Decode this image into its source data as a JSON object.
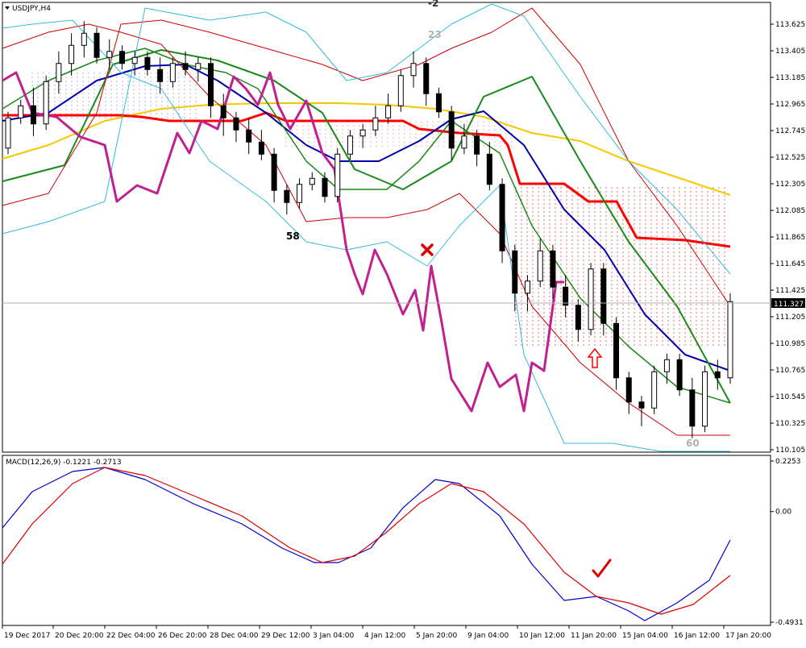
{
  "main_chart": {
    "title": "USDJPY,H4",
    "current_price": "111.327",
    "y_ticks": [
      "113.625",
      "113.405",
      "113.185",
      "112.965",
      "112.745",
      "112.525",
      "112.305",
      "112.085",
      "111.865",
      "111.645",
      "111.425",
      "111.205",
      "110.985",
      "110.765",
      "110.545",
      "110.325",
      "110.105"
    ],
    "annotations": {
      "top_number": "-2",
      "gray_number": "23",
      "low_number": "58",
      "bottom_number": "60"
    }
  },
  "macd_panel": {
    "title": "MACD(12,26,9) -0.1221 -0.2713",
    "y_ticks": [
      "0.2253",
      "0.00",
      "-0.4931"
    ]
  },
  "x_ticks": [
    "19 Dec 2017",
    "20 Dec 20:00",
    "22 Dec 04:00",
    "26 Dec 20:00",
    "28 Dec 04:00",
    "29 Dec 12:00",
    "3 Jan 04:00",
    "4 Jan 12:00",
    "5 Jan 20:00",
    "9 Jan 04:00",
    "10 Jan 12:00",
    "11 Jan 20:00",
    "15 Jan 04:00",
    "16 Jan 12:00",
    "17 Jan 20:00"
  ],
  "colors": {
    "bull_candle": "#ffffff",
    "bear_candle": "#000000",
    "ma_fast": "#0000aa",
    "ma_slow": "#f5c800",
    "stop_line": "#ff0000",
    "bollinger_inner": "#1a8a1a",
    "bollinger_outer": "#cc0000",
    "envelope": "#33bbdd",
    "oscillator": "#c02090",
    "macd_line": "#0000cc",
    "signal_line": "#dd0000",
    "cross_mark": "#dd0000",
    "check_mark": "#dd0000",
    "arrow": "#ff0000"
  },
  "chart_data": {
    "type": "candlestick",
    "symbol": "USDJPY",
    "timeframe": "H4",
    "y_range": [
      110.105,
      113.625
    ],
    "ohlc": [
      {
        "o": 112.6,
        "h": 112.9,
        "l": 112.55,
        "c": 112.85
      },
      {
        "o": 112.85,
        "h": 113.0,
        "l": 112.8,
        "c": 112.95
      },
      {
        "o": 112.95,
        "h": 113.1,
        "l": 112.7,
        "c": 112.8
      },
      {
        "o": 112.8,
        "h": 113.2,
        "l": 112.75,
        "c": 113.15
      },
      {
        "o": 113.15,
        "h": 113.4,
        "l": 113.05,
        "c": 113.3
      },
      {
        "o": 113.3,
        "h": 113.55,
        "l": 113.2,
        "c": 113.45
      },
      {
        "o": 113.45,
        "h": 113.65,
        "l": 113.35,
        "c": 113.55
      },
      {
        "o": 113.55,
        "h": 113.6,
        "l": 113.3,
        "c": 113.35
      },
      {
        "o": 113.35,
        "h": 113.5,
        "l": 113.25,
        "c": 113.4
      },
      {
        "o": 113.4,
        "h": 113.45,
        "l": 113.25,
        "c": 113.3
      },
      {
        "o": 113.3,
        "h": 113.4,
        "l": 113.2,
        "c": 113.35
      },
      {
        "o": 113.35,
        "h": 113.4,
        "l": 113.2,
        "c": 113.25
      },
      {
        "o": 113.25,
        "h": 113.35,
        "l": 113.05,
        "c": 113.15
      },
      {
        "o": 113.15,
        "h": 113.35,
        "l": 113.1,
        "c": 113.3
      },
      {
        "o": 113.3,
        "h": 113.4,
        "l": 113.2,
        "c": 113.25
      },
      {
        "o": 113.25,
        "h": 113.35,
        "l": 113.15,
        "c": 113.3
      },
      {
        "o": 113.3,
        "h": 113.35,
        "l": 112.85,
        "c": 112.95
      },
      {
        "o": 112.95,
        "h": 113.05,
        "l": 112.7,
        "c": 112.85
      },
      {
        "o": 112.85,
        "h": 112.9,
        "l": 112.65,
        "c": 112.75
      },
      {
        "o": 112.75,
        "h": 112.85,
        "l": 112.55,
        "c": 112.65
      },
      {
        "o": 112.65,
        "h": 112.75,
        "l": 112.5,
        "c": 112.55
      },
      {
        "o": 112.55,
        "h": 112.6,
        "l": 112.15,
        "c": 112.25
      },
      {
        "o": 112.25,
        "h": 112.3,
        "l": 112.05,
        "c": 112.15
      },
      {
        "o": 112.15,
        "h": 112.35,
        "l": 112.1,
        "c": 112.3
      },
      {
        "o": 112.3,
        "h": 112.4,
        "l": 112.25,
        "c": 112.35
      },
      {
        "o": 112.35,
        "h": 112.4,
        "l": 112.15,
        "c": 112.2
      },
      {
        "o": 112.2,
        "h": 112.6,
        "l": 112.15,
        "c": 112.55
      },
      {
        "o": 112.55,
        "h": 112.75,
        "l": 112.5,
        "c": 112.7
      },
      {
        "o": 112.7,
        "h": 112.8,
        "l": 112.6,
        "c": 112.75
      },
      {
        "o": 112.75,
        "h": 112.95,
        "l": 112.7,
        "c": 112.85
      },
      {
        "o": 112.85,
        "h": 113.05,
        "l": 112.8,
        "c": 112.95
      },
      {
        "o": 112.95,
        "h": 113.25,
        "l": 112.9,
        "c": 113.2
      },
      {
        "o": 113.2,
        "h": 113.4,
        "l": 113.1,
        "c": 113.3
      },
      {
        "o": 113.3,
        "h": 113.35,
        "l": 112.95,
        "c": 113.05
      },
      {
        "o": 113.05,
        "h": 113.1,
        "l": 112.85,
        "c": 112.9
      },
      {
        "o": 112.9,
        "h": 112.95,
        "l": 112.5,
        "c": 112.6
      },
      {
        "o": 112.6,
        "h": 112.8,
        "l": 112.55,
        "c": 112.7
      },
      {
        "o": 112.7,
        "h": 112.75,
        "l": 112.45,
        "c": 112.55
      },
      {
        "o": 112.55,
        "h": 112.65,
        "l": 112.25,
        "c": 112.3
      },
      {
        "o": 112.3,
        "h": 112.35,
        "l": 111.65,
        "c": 111.75
      },
      {
        "o": 111.75,
        "h": 111.8,
        "l": 111.25,
        "c": 111.4
      },
      {
        "o": 111.4,
        "h": 111.55,
        "l": 111.25,
        "c": 111.5
      },
      {
        "o": 111.5,
        "h": 111.85,
        "l": 111.45,
        "c": 111.75
      },
      {
        "o": 111.75,
        "h": 111.8,
        "l": 111.35,
        "c": 111.45
      },
      {
        "o": 111.45,
        "h": 111.55,
        "l": 111.2,
        "c": 111.3
      },
      {
        "o": 111.3,
        "h": 111.35,
        "l": 111.0,
        "c": 111.1
      },
      {
        "o": 111.1,
        "h": 111.65,
        "l": 111.05,
        "c": 111.6
      },
      {
        "o": 111.6,
        "h": 111.65,
        "l": 111.05,
        "c": 111.15
      },
      {
        "o": 111.15,
        "h": 111.2,
        "l": 110.6,
        "c": 110.7
      },
      {
        "o": 110.7,
        "h": 110.75,
        "l": 110.4,
        "c": 110.5
      },
      {
        "o": 110.5,
        "h": 110.55,
        "l": 110.3,
        "c": 110.45
      },
      {
        "o": 110.45,
        "h": 110.8,
        "l": 110.4,
        "c": 110.75
      },
      {
        "o": 110.75,
        "h": 110.9,
        "l": 110.65,
        "c": 110.85
      },
      {
        "o": 110.85,
        "h": 110.9,
        "l": 110.55,
        "c": 110.6
      },
      {
        "o": 110.6,
        "h": 110.7,
        "l": 110.2,
        "c": 110.3
      },
      {
        "o": 110.3,
        "h": 110.8,
        "l": 110.25,
        "c": 110.75
      },
      {
        "o": 110.75,
        "h": 110.85,
        "l": 110.6,
        "c": 110.7
      },
      {
        "o": 110.7,
        "h": 111.4,
        "l": 110.65,
        "c": 111.33
      }
    ],
    "macd": {
      "value": -0.1221,
      "signal": -0.2713,
      "params": [
        12,
        26,
        9
      ],
      "y_range": [
        -0.4931,
        0.2253
      ]
    }
  }
}
